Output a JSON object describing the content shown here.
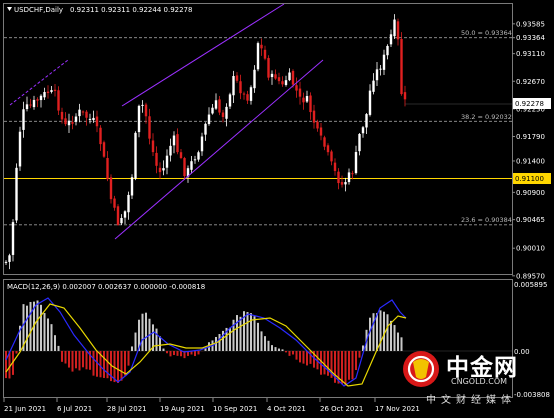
{
  "header": {
    "symbol": "USDCHF,Daily",
    "ohlc": "0.92311 0.92311 0.92244 0.92278"
  },
  "chart_data": {
    "type": "candlestick",
    "symbol": "USDCHF",
    "timeframe": "Daily",
    "y_ticks": [
      0.93585,
      0.93364,
      0.9311,
      0.9267,
      0.9223,
      0.9179,
      0.914,
      0.9111,
      0.909,
      0.90465,
      0.9001,
      0.8957
    ],
    "y_tick_labels": [
      "0.93585",
      "0.93364",
      "0.93110",
      "0.92670",
      "0.92230",
      "0.91790",
      "0.91400",
      "0.91100",
      "0.90900",
      "0.90465",
      "0.90010",
      "0.89570"
    ],
    "x_labels": [
      "21 Jun 2021",
      "6 Jul 2021",
      "28 Jul 2021",
      "19 Aug 2021",
      "10 Sep 2021",
      "4 Oct 2021",
      "26 Oct 2021",
      "17 Nov 2021"
    ],
    "current_price": 0.92278,
    "current_price_label": "0.92278",
    "horizontal_line": {
      "price": 0.911,
      "label": "0.91100",
      "color": "#ffd700"
    },
    "fibonacci": [
      {
        "label": "50.0 = 0.93364",
        "price": 0.93364
      },
      {
        "label": "38.2 = 0.92032",
        "price": 0.92032
      },
      {
        "label": "23.6 = 0.90384",
        "price": 0.90384
      }
    ],
    "bull_color": "#ffffff",
    "bear_color": "#e02020",
    "channel_color": "#9b30ff"
  },
  "macd": {
    "title": "MACD(12,26,9) 0.002007 0.002637 0.000000 -0.000818",
    "ticks": [
      "0.005895",
      "0.00",
      "-0.003808"
    ],
    "hist_up_color": "#c8c8c8",
    "hist_down_color": "#d02020",
    "macd_line_color": "#2a2aff",
    "signal_line_color": "#e8d800"
  },
  "watermark": {
    "brand": "中金网",
    "site": "CNGOLD.COM",
    "slogan": "中文财经媒体"
  }
}
